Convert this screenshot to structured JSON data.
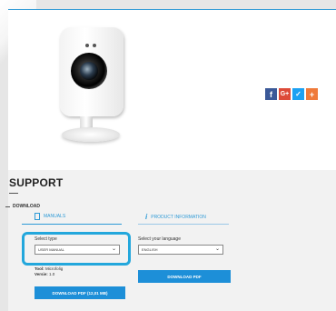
{
  "share": {
    "icons": [
      {
        "name": "facebook-icon",
        "glyph": "f"
      },
      {
        "name": "google-plus-icon",
        "glyph": "G+"
      },
      {
        "name": "twitter-icon",
        "glyph": "✓"
      },
      {
        "name": "share-plus-icon",
        "glyph": "+"
      }
    ]
  },
  "support": {
    "title": "SUPPORT",
    "download_label": "DOWNLOAD",
    "tabs": {
      "manuals": "MANUALS",
      "product_information": "PRODUCT INFORMATION"
    },
    "select_type": {
      "label": "Select type",
      "value": "USER MANUAL"
    },
    "select_language": {
      "label": "Select your language",
      "value": "ENGLISH"
    },
    "meta": {
      "tool_label": "Tool:",
      "tool_value": "Microfolig",
      "version_label": "Versie:",
      "version_value": "1.0"
    },
    "download_pdf_size": "DOWNLOAD PDF (12,01 MB)",
    "download_pdf": "DOWNLOAD PDF"
  },
  "colors": {
    "accent": "#2e9ad6",
    "button": "#1d8fd8",
    "highlight": "#23a7dc"
  }
}
